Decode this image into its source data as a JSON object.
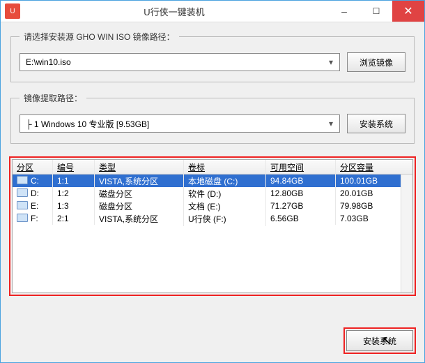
{
  "window": {
    "title": "U行侠一键装机"
  },
  "group_source": {
    "legend": "请选择安装源 GHO WIN ISO 镜像路径：",
    "select_value": "E:\\win10.iso",
    "browse_btn": "浏览镜像"
  },
  "group_extract": {
    "legend": "镜像提取路径：",
    "select_value": "├ 1 Windows 10 专业版 [9.53GB]",
    "install_btn": "安装系统"
  },
  "table": {
    "headers": [
      "分区",
      "编号",
      "类型",
      "卷标",
      "可用空间",
      "分区容量"
    ],
    "rows": [
      {
        "drive": "C:",
        "num": "1:1",
        "type": "VISTA,系统分区",
        "label": "本地磁盘 (C:)",
        "free": "94.84GB",
        "total": "100.01GB",
        "selected": true
      },
      {
        "drive": "D:",
        "num": "1:2",
        "type": "磁盘分区",
        "label": "软件 (D:)",
        "free": "12.80GB",
        "total": "20.01GB",
        "selected": false
      },
      {
        "drive": "E:",
        "num": "1:3",
        "type": "磁盘分区",
        "label": "文档 (E:)",
        "free": "71.27GB",
        "total": "79.98GB",
        "selected": false
      },
      {
        "drive": "F:",
        "num": "2:1",
        "type": "VISTA,系统分区",
        "label": "U行侠 (F:)",
        "free": "6.56GB",
        "total": "7.03GB",
        "selected": false
      }
    ]
  },
  "footer": {
    "install_btn": "安装系统"
  }
}
